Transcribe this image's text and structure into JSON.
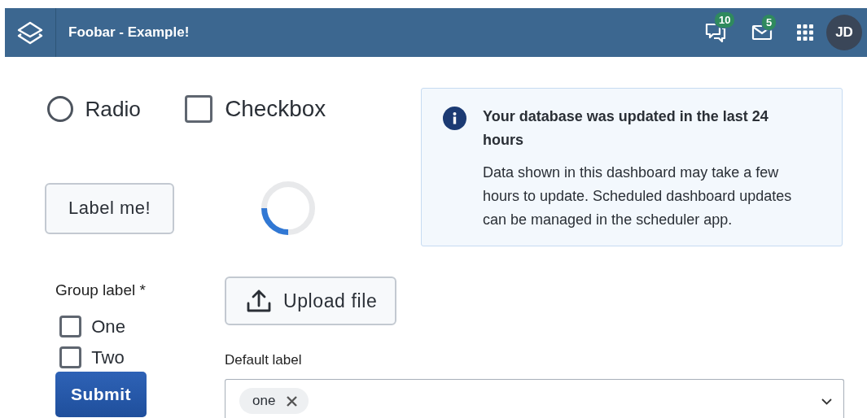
{
  "header": {
    "title": "Foobar - Example!",
    "notifications": [
      {
        "kind": "chat",
        "count": "10"
      },
      {
        "kind": "mail",
        "count": "5"
      }
    ],
    "avatar": "JD"
  },
  "radio": {
    "label": "Radio",
    "selected": false
  },
  "checkbox": {
    "label": "Checkbox",
    "checked": false
  },
  "label_button": "Label me!",
  "alert": {
    "title": "Your database was updated in the last 24 hours",
    "body": "Data shown in this dashboard may take a few hours to update. Scheduled dashboard updates can be managed in the scheduler app."
  },
  "group": {
    "label": "Group label *",
    "options": [
      {
        "label": "One",
        "checked": false
      },
      {
        "label": "Two",
        "checked": false
      }
    ]
  },
  "submit_button": "Submit",
  "upload_button": "Upload file",
  "select": {
    "label": "Default label",
    "chips": [
      {
        "label": "one"
      }
    ]
  }
}
